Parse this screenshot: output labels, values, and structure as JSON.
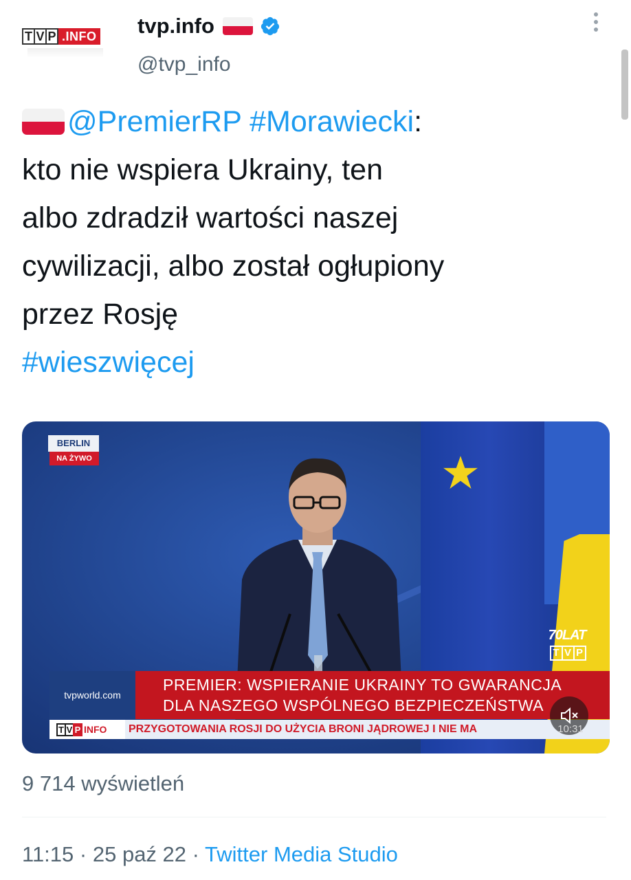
{
  "header": {
    "avatar": {
      "logo_letters": [
        "T",
        "V",
        "P"
      ],
      "logo_suffix": ".INFO"
    },
    "display_name": "tvp.info",
    "handle": "@tvp_info",
    "flag_icon": "poland-flag-icon",
    "verified_icon": "verified-badge-icon",
    "more_icon": "more-options-icon"
  },
  "tweet": {
    "mention": "@PremierRP",
    "hashtag_1": "#Morawiecki",
    "colon": ":",
    "lines": [
      "kto nie wspiera Ukrainy, ten",
      "albo zdradził wartości naszej",
      "cywilizacji, albo został ogłupiony",
      "przez Rosję"
    ],
    "hashtag_2": "#wieszwięcej"
  },
  "media": {
    "location": "BERLIN",
    "live_label": "NA ŻYWO",
    "anniversary_line1": "70LAT",
    "anniversary_letters": [
      "T",
      "V",
      "P"
    ],
    "site": "tvpworld.com",
    "headline_1": "PREMIER: WSPIERANIE UKRAINY TO GWARANCJA",
    "headline_2": "DLA NASZEGO WSPÓLNEGO BEZPIECZEŃSTWA",
    "ticker_logo_letters": [
      "T",
      "V",
      "P"
    ],
    "ticker_logo_suffix": "INFO",
    "ticker": "PRZYGOTOWANIA ROSJI DO UŻYCIA BRONI JĄDROWEJ I NIE MA",
    "duration": "10:31",
    "mute_icon": "muted-speaker-icon"
  },
  "stats": {
    "views": "9 714 wyświetleń"
  },
  "meta": {
    "time": "11:15",
    "separator": "·",
    "date": "25 paź 22",
    "source": "Twitter Media Studio"
  },
  "colors": {
    "link": "#1d9bf0",
    "secondary_text": "#536471",
    "tvp_red": "#d91c2a",
    "lower_third_red": "#c3161f",
    "lower_third_blue": "#1e3f80"
  }
}
